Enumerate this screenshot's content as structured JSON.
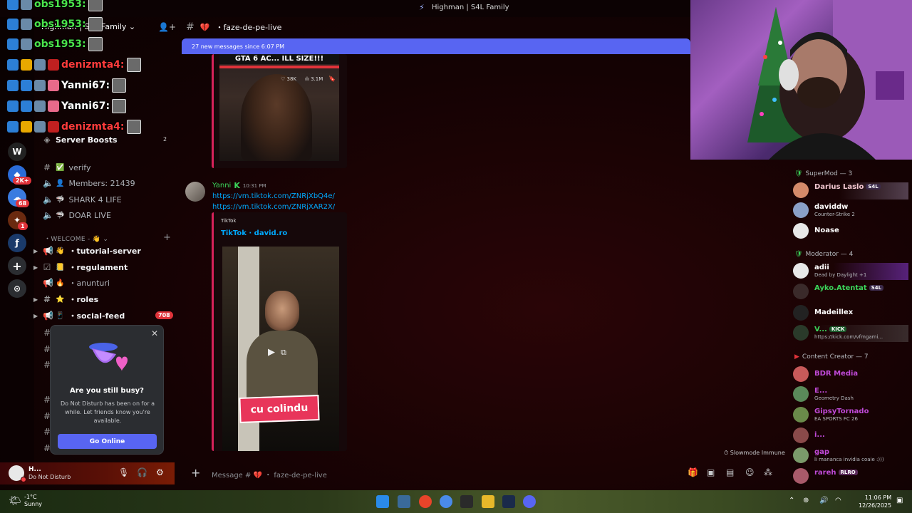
{
  "window": {
    "title": "Highman | S4L Family"
  },
  "server": {
    "name": "Highman | S4L Family"
  },
  "rail": {
    "badges": [
      "2K+",
      "68",
      "1"
    ]
  },
  "sidebar": {
    "server_boosts": {
      "label": "Server Boosts",
      "count": "2"
    },
    "channels_top": [
      {
        "label": "verify",
        "icon": "check-icon"
      },
      {
        "label": "Members: 21439",
        "icon": "speaker-icon"
      },
      {
        "label": "SHARK 4 LIFE",
        "icon": "speaker-icon"
      },
      {
        "label": "DOAR LIVE",
        "icon": "speaker-icon"
      }
    ],
    "category": "WELCOME - 👋",
    "channels": [
      {
        "label": "tutorial-server",
        "emoji": "👋"
      },
      {
        "label": "regulament",
        "emoji": "📒"
      },
      {
        "label": "anunturi",
        "emoji": "🔥"
      },
      {
        "label": "roles",
        "emoji": "⭐"
      },
      {
        "label": "social-feed",
        "emoji": "📱",
        "badge": "708"
      }
    ],
    "overlay_chat": [
      {
        "name": "obs1953:",
        "color": "#4be34b"
      },
      {
        "name": "obs1953:",
        "color": "#4be34b"
      },
      {
        "name": "obs1953:",
        "color": "#4be34b"
      },
      {
        "name": "denizmta4:",
        "color": "#ff3b3b"
      },
      {
        "name": "Yanni67:",
        "color": "#ffffff"
      },
      {
        "name": "Yanni67:",
        "color": "#ffffff"
      },
      {
        "name": "denizmta4:",
        "color": "#ff3b3b"
      }
    ]
  },
  "popup": {
    "title": "Are you still busy?",
    "message": "Do Not Disturb has been on for a while. Let friends know you're available.",
    "button": "Go Online"
  },
  "user_panel": {
    "name": "H...",
    "status": "Do Not Disturb"
  },
  "channel": {
    "name": "faze-de-pe-live"
  },
  "new_messages_bar": "27 new messages since 6:07 PM",
  "embed1": {
    "caption": "GTA 6 AC... ILL SIZE!!!",
    "likes": "38K",
    "views": "3.1M"
  },
  "message": {
    "author": "Yanni",
    "time": "10:31 PM",
    "links": [
      "https://vm.tiktok.com/ZNRjXbQ4e/",
      "https://vm.tiktok.com/ZNRjXAR2X/"
    ],
    "embed_provider": "TikTok",
    "embed_title": "TikTok · david.ro",
    "video_caption": "cu colindu"
  },
  "composer": {
    "placeholder": "Message # 💔 ・ faze-de-pe-live"
  },
  "slowmode": "Slowmode Immune",
  "members": {
    "groups": [
      {
        "title": "SuperMod — 3",
        "items": [
          {
            "name": "Darius Laslo",
            "color": "#f2c7d0",
            "tag": "S4L",
            "status": ""
          },
          {
            "name": "daviddw",
            "color": "#ffffff",
            "status": "Counter-Strike 2"
          },
          {
            "name": "Noase",
            "color": "#ffffff",
            "status": ""
          }
        ]
      },
      {
        "title": "Moderator — 4",
        "items": [
          {
            "name": "adii",
            "color": "#ffffff",
            "status": "Dead by Daylight +1"
          },
          {
            "name": "Ayko.Atentat",
            "color": "#3bd45a",
            "tag": "S4L",
            "status": ""
          },
          {
            "name": "Madeillex",
            "color": "#ffffff",
            "status": ""
          },
          {
            "name": "V...",
            "color": "#3bd45a",
            "tag": "KICK",
            "status": "https://kick.com/vfmgami..."
          }
        ]
      },
      {
        "title": "Content Creator — 7",
        "items": [
          {
            "name": "BDR Media",
            "color": "#c04ad8",
            "status": ""
          },
          {
            "name": "E...",
            "color": "#c04ad8",
            "status": "Geometry Dash"
          },
          {
            "name": "GipsyTornado",
            "color": "#c04ad8",
            "status": "EA SPORTS FC 26"
          },
          {
            "name": "i...",
            "color": "#c04ad8",
            "status": ""
          },
          {
            "name": "gap",
            "color": "#c04ad8",
            "status": "li mananca invidia coaie :)))"
          },
          {
            "name": "rareh",
            "color": "#c04ad8",
            "tag": "RLRO",
            "status": ""
          }
        ]
      }
    ]
  },
  "taskbar": {
    "weather_temp": "-1°C",
    "weather_desc": "Sunny",
    "time": "11:06 PM",
    "date": "12/26/2025"
  },
  "colors": {
    "accent": "#5865f2",
    "dnd": "#f23f43",
    "badge": "#e0333a",
    "link": "#00a8fc"
  }
}
